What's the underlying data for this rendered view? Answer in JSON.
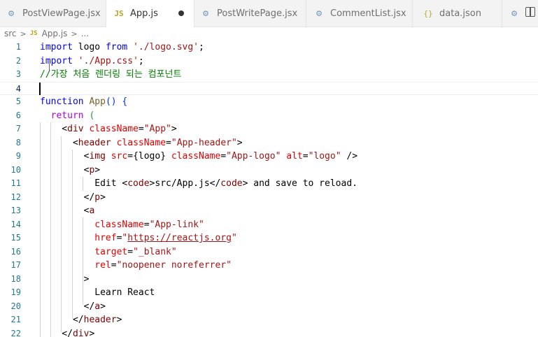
{
  "tabs": [
    {
      "label": "PostViewPage.jsx",
      "icon": "gear-icon",
      "active": false
    },
    {
      "label": "App.js",
      "icon": "js-file-icon",
      "active": true,
      "dirty": true
    },
    {
      "label": "PostWritePage.jsx",
      "icon": "gear-icon",
      "active": false
    },
    {
      "label": "CommentList.jsx",
      "icon": "gear-icon",
      "active": false
    },
    {
      "label": "data.json",
      "icon": "json-braces-icon",
      "active": false
    }
  ],
  "breadcrumb": {
    "folder": "src",
    "sep": ">",
    "file": "App.js",
    "ellipsis": "...",
    "js_badge": "JS"
  },
  "editor": {
    "current_line": 4,
    "lines": [
      {
        "n": "1",
        "segs": [
          [
            "kw",
            "import"
          ],
          [
            "txt",
            " logo "
          ],
          [
            "kw",
            "from"
          ],
          [
            "txt",
            " "
          ],
          [
            "str",
            "'./logo.svg'"
          ],
          [
            "txt",
            ";"
          ]
        ]
      },
      {
        "n": "2",
        "segs": [
          [
            "kw",
            "import"
          ],
          [
            "txt",
            " "
          ],
          [
            "str",
            "'./App.css'"
          ],
          [
            "txt",
            ";"
          ]
        ]
      },
      {
        "n": "3",
        "segs": [
          [
            "cmt",
            "//가장 처음 렌더링 되는 컴포넌트"
          ]
        ]
      },
      {
        "n": "4",
        "segs": []
      },
      {
        "n": "5",
        "segs": [
          [
            "kw",
            "function"
          ],
          [
            "txt",
            " "
          ],
          [
            "fn",
            "App"
          ],
          [
            "br1",
            "()"
          ],
          [
            "txt",
            " "
          ],
          [
            "br1",
            "{"
          ]
        ]
      },
      {
        "n": "6",
        "segs": [
          [
            "txt",
            "  "
          ],
          [
            "ctl",
            "return"
          ],
          [
            "txt",
            " "
          ],
          [
            "br2",
            "("
          ]
        ]
      },
      {
        "n": "7",
        "segs": [
          [
            "txt",
            "    <"
          ],
          [
            "tag",
            "div"
          ],
          [
            "txt",
            " "
          ],
          [
            "attr",
            "className"
          ],
          [
            "txt",
            "="
          ],
          [
            "str",
            "\"App\""
          ],
          [
            "txt",
            ">"
          ]
        ]
      },
      {
        "n": "8",
        "segs": [
          [
            "txt",
            "      <"
          ],
          [
            "tag",
            "header"
          ],
          [
            "txt",
            " "
          ],
          [
            "attr",
            "className"
          ],
          [
            "txt",
            "="
          ],
          [
            "str",
            "\"App-header\""
          ],
          [
            "txt",
            ">"
          ]
        ]
      },
      {
        "n": "9",
        "segs": [
          [
            "txt",
            "        <"
          ],
          [
            "tag",
            "img"
          ],
          [
            "txt",
            " "
          ],
          [
            "attr",
            "src"
          ],
          [
            "txt",
            "="
          ],
          [
            "txt",
            "{logo}"
          ],
          [
            "txt",
            " "
          ],
          [
            "attr",
            "className"
          ],
          [
            "txt",
            "="
          ],
          [
            "str",
            "\"App-logo\""
          ],
          [
            "txt",
            " "
          ],
          [
            "attr",
            "alt"
          ],
          [
            "txt",
            "="
          ],
          [
            "str",
            "\"logo\""
          ],
          [
            "txt",
            " />"
          ]
        ]
      },
      {
        "n": "10",
        "segs": [
          [
            "txt",
            "        <"
          ],
          [
            "tag",
            "p"
          ],
          [
            "txt",
            ">"
          ]
        ]
      },
      {
        "n": "11",
        "segs": [
          [
            "txt",
            "          Edit <"
          ],
          [
            "tag",
            "code"
          ],
          [
            "txt",
            ">src/App.js</"
          ],
          [
            "tag",
            "code"
          ],
          [
            "txt",
            "> and save to reload."
          ]
        ]
      },
      {
        "n": "12",
        "segs": [
          [
            "txt",
            "        </"
          ],
          [
            "tag",
            "p"
          ],
          [
            "txt",
            ">"
          ]
        ]
      },
      {
        "n": "13",
        "segs": [
          [
            "txt",
            "        <"
          ],
          [
            "tag",
            "a"
          ]
        ]
      },
      {
        "n": "14",
        "segs": [
          [
            "txt",
            "          "
          ],
          [
            "attr",
            "className"
          ],
          [
            "txt",
            "="
          ],
          [
            "str",
            "\"App-link\""
          ]
        ]
      },
      {
        "n": "15",
        "segs": [
          [
            "txt",
            "          "
          ],
          [
            "attr",
            "href"
          ],
          [
            "txt",
            "="
          ],
          [
            "str",
            "\""
          ],
          [
            "link",
            "https://reactjs.org"
          ],
          [
            "str",
            "\""
          ]
        ]
      },
      {
        "n": "16",
        "segs": [
          [
            "txt",
            "          "
          ],
          [
            "attr",
            "target"
          ],
          [
            "txt",
            "="
          ],
          [
            "str",
            "\"_blank\""
          ]
        ]
      },
      {
        "n": "17",
        "segs": [
          [
            "txt",
            "          "
          ],
          [
            "attr",
            "rel"
          ],
          [
            "txt",
            "="
          ],
          [
            "str",
            "\"noopener noreferrer\""
          ]
        ]
      },
      {
        "n": "18",
        "segs": [
          [
            "txt",
            "        >"
          ]
        ]
      },
      {
        "n": "19",
        "segs": [
          [
            "txt",
            "          Learn React"
          ]
        ]
      },
      {
        "n": "20",
        "segs": [
          [
            "txt",
            "        </"
          ],
          [
            "tag",
            "a"
          ],
          [
            "txt",
            ">"
          ]
        ]
      },
      {
        "n": "21",
        "segs": [
          [
            "txt",
            "      </"
          ],
          [
            "tag",
            "header"
          ],
          [
            "txt",
            ">"
          ]
        ]
      },
      {
        "n": "22",
        "segs": [
          [
            "txt",
            "    </"
          ],
          [
            "tag",
            "div"
          ],
          [
            "txt",
            ">"
          ]
        ]
      }
    ]
  }
}
